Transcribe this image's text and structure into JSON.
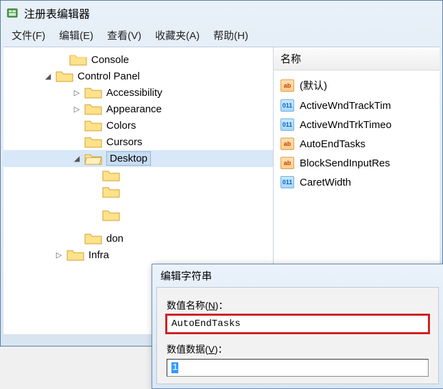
{
  "window": {
    "title": "注册表编辑器"
  },
  "menu": {
    "file": "文件(F)",
    "edit": "编辑(E)",
    "view": "查看(V)",
    "fav": "收藏夹(A)",
    "help": "帮助(H)"
  },
  "tree": {
    "console": "Console",
    "control_panel": "Control Panel",
    "accessibility": "Accessibility",
    "appearance": "Appearance",
    "colors": "Colors",
    "cursors": "Cursors",
    "desktop": "Desktop",
    "desktop_child1": "",
    "desktop_child2": "",
    "don": "don",
    "infra": "Infra"
  },
  "list": {
    "header": "名称",
    "items": [
      {
        "type": "string",
        "name": "(默认)"
      },
      {
        "type": "binary",
        "name": "ActiveWndTrackTim"
      },
      {
        "type": "binary",
        "name": "ActiveWndTrkTimeo"
      },
      {
        "type": "string",
        "name": "AutoEndTasks"
      },
      {
        "type": "string",
        "name": "BlockSendInputRes"
      },
      {
        "type": "binary",
        "name": "CaretWidth"
      }
    ]
  },
  "dialog": {
    "title": "编辑字符串",
    "name_label_pre": "数值名称(",
    "name_label_u": "N",
    "name_label_post": ")：",
    "name_value": "AutoEndTasks",
    "data_label_pre": "数值数据(",
    "data_label_u": "V",
    "data_label_post": ")：",
    "data_value": "1"
  }
}
